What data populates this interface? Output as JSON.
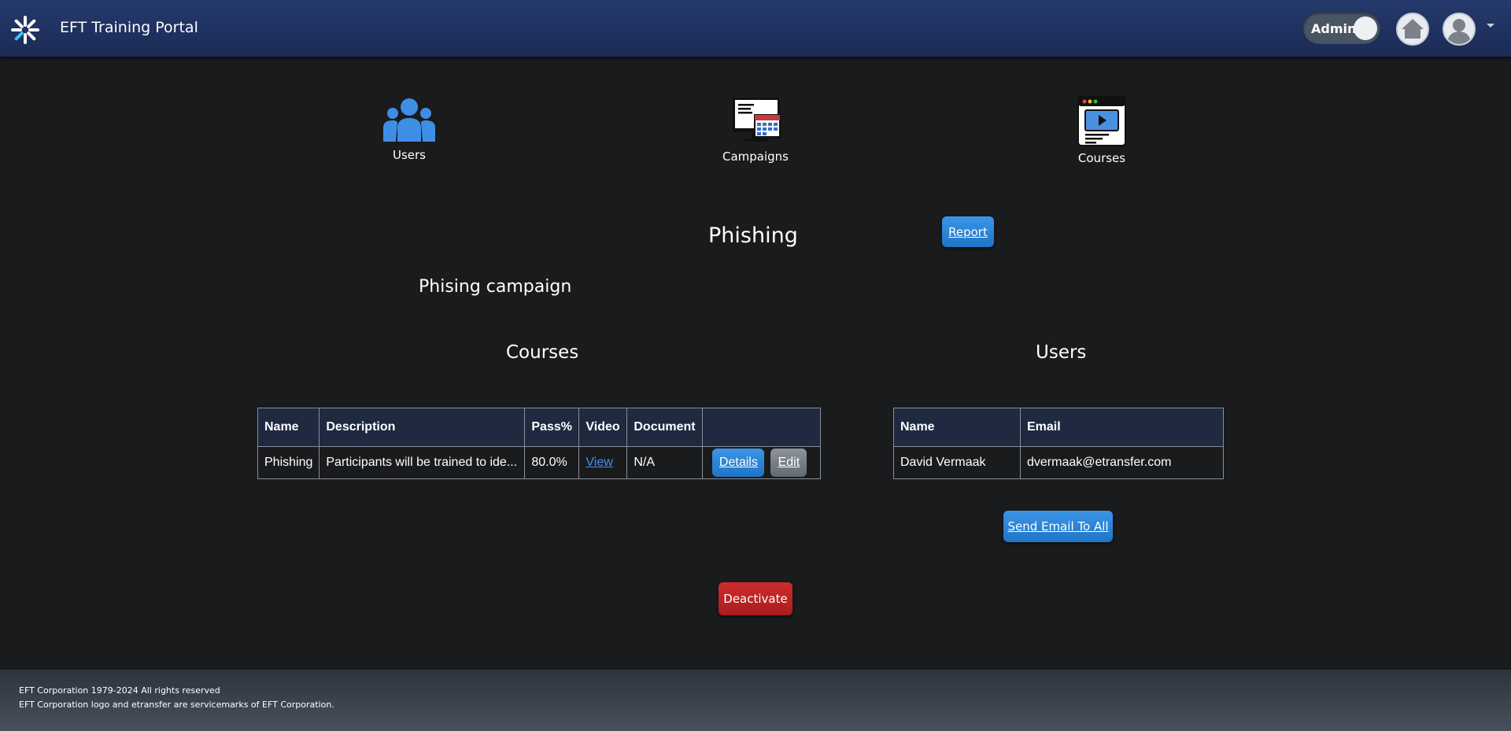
{
  "header": {
    "title": "EFT Training Portal",
    "admin_toggle_label": "Admin"
  },
  "nav": {
    "users": "Users",
    "campaigns": "Campaigns",
    "courses": "Courses"
  },
  "campaign": {
    "title": "Phishing",
    "report_label": "Report",
    "name": "Phising campaign"
  },
  "courses_section": {
    "heading": "Courses",
    "columns": [
      "Name",
      "Description",
      "Pass%",
      "Video",
      "Document",
      ""
    ],
    "rows": [
      {
        "name": "Phishing",
        "description": "Participants will be trained to ide...",
        "pass": "80.0%",
        "video": "View",
        "document": "N/A",
        "details_label": "Details",
        "edit_label": "Edit"
      }
    ]
  },
  "users_section": {
    "heading": "Users",
    "columns": [
      "Name",
      "Email"
    ],
    "rows": [
      {
        "name": "David Vermaak",
        "email": "dvermaak@etransfer.com"
      }
    ],
    "send_email_label": "Send Email To All"
  },
  "deactivate_label": "Deactivate",
  "footer": {
    "line1": "EFT Corporation 1979-2024 All rights reserved",
    "line2": "EFT Corporation logo and etransfer are servicemarks of EFT Corporation."
  },
  "colors": {
    "header_bg": "#1f3160",
    "primary_button": "#2f87da",
    "danger_button": "#c02424",
    "secondary_button": "#737b84",
    "link": "#4a8ef0"
  }
}
